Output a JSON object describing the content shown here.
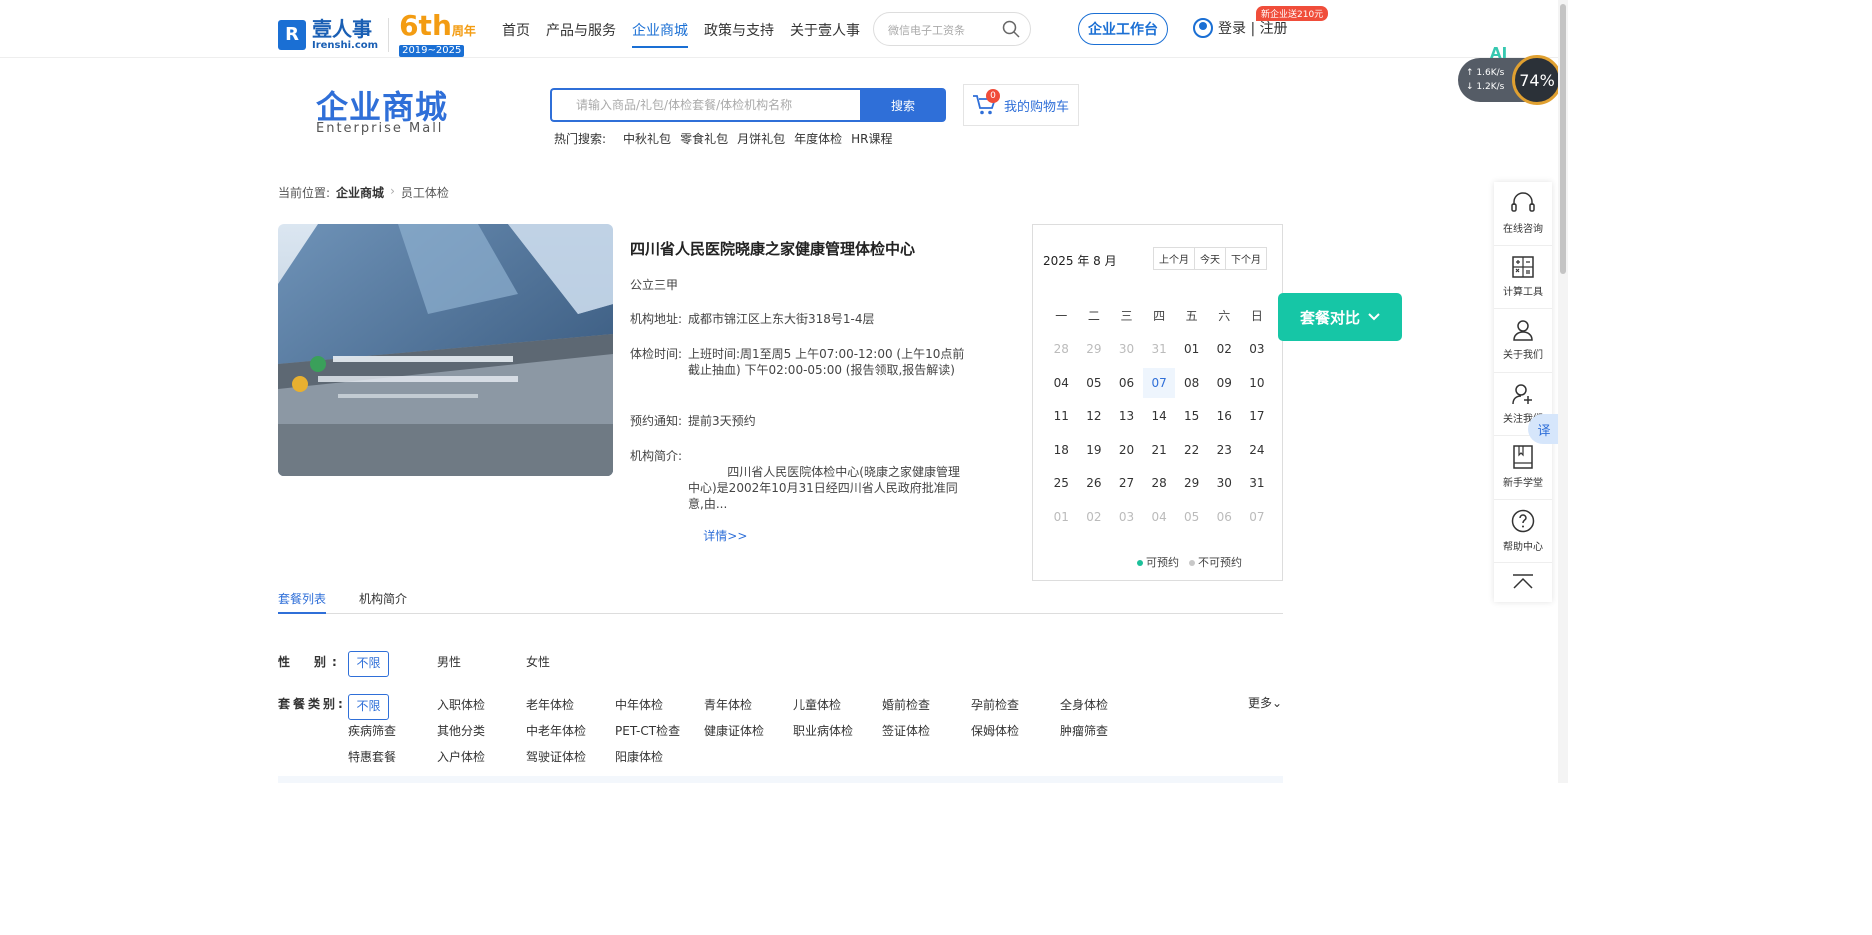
{
  "header": {
    "logo": {
      "cn": "壹人事",
      "en": "Irenshi.com",
      "mark": "R"
    },
    "anniversary": {
      "big": "6th",
      "small": "周年",
      "years": "2019~2025"
    },
    "nav": [
      "首页",
      "产品与服务",
      "企业商城",
      "政策与支持",
      "关于壹人事"
    ],
    "search_placeholder": "微信电子工资条",
    "workbench": "企业工作台",
    "login": "登录 | 注册",
    "promo": "新企业送210元"
  },
  "mall": {
    "title": "企业商城",
    "subtitle": "Enterprise  Mall",
    "search_placeholder": "请输入商品/礼包/体检套餐/体检机构名称",
    "search_button": "搜索",
    "hot_label": "热门搜索:",
    "hot": [
      "中秋礼包",
      "零食礼包",
      "月饼礼包",
      "年度体检",
      "HR课程"
    ],
    "cart_label": "我的购物车",
    "cart_count": "0"
  },
  "breadcrumb": {
    "prefix": "当前位置:",
    "items": [
      "企业商城",
      "员工体检"
    ]
  },
  "institution": {
    "name": "四川省人民医院晓康之家健康管理体检中心",
    "tag": "公立三甲",
    "address_label": "机构地址:",
    "address": "成都市锦江区上东大街318号1-4层",
    "time_label": "体检时间:",
    "time": "上班时间:周1至周5 上午07:00-12:00 (上午10点前截止抽血) 下午02:00-05:00 (报告领取,报告解读)",
    "notice_label": "预约通知:",
    "notice": "提前3天预约",
    "intro_label": "机构简介:",
    "intro": "　　四川省人民医院体检中心(晓康之家健康管理中心)是2002年10月31日经四川省人民政府批准同意,由...",
    "detail": "详情>>"
  },
  "calendar": {
    "title": "2025 年 8 月",
    "buttons": [
      "上个月",
      "今天",
      "下个月"
    ],
    "weekdays": [
      "一",
      "二",
      "三",
      "四",
      "五",
      "六",
      "日"
    ],
    "weeks": [
      [
        "28",
        "29",
        "30",
        "31",
        "01",
        "02",
        "03"
      ],
      [
        "04",
        "05",
        "06",
        "07",
        "08",
        "09",
        "10"
      ],
      [
        "11",
        "12",
        "13",
        "14",
        "15",
        "16",
        "17"
      ],
      [
        "18",
        "19",
        "20",
        "21",
        "22",
        "23",
        "24"
      ],
      [
        "25",
        "26",
        "27",
        "28",
        "29",
        "30",
        "31"
      ],
      [
        "01",
        "02",
        "03",
        "04",
        "05",
        "06",
        "07"
      ]
    ],
    "today": "07",
    "legend_available": "可预约",
    "legend_unavailable": "不可预约",
    "available_color": "#1cc09a",
    "unavailable_color": "#c8c8c8"
  },
  "compare_button": "套餐对比",
  "tabs": [
    "套餐列表",
    "机构简介"
  ],
  "filters": {
    "gender_label": "性　别:",
    "gender": [
      "不限",
      "男性",
      "女性"
    ],
    "type_label": "套餐类别:",
    "types": [
      "不限",
      "入职体检",
      "老年体检",
      "中年体检",
      "青年体检",
      "儿童体检",
      "婚前检查",
      "孕前检查",
      "全身体检",
      "疾病筛查",
      "其他分类",
      "中老年体检",
      "PET-CT检查",
      "健康证体检",
      "职业病体检",
      "签证体检",
      "保姆体检",
      "肿瘤筛查",
      "特惠套餐",
      "入户体检",
      "驾驶证体检",
      "阳康体检"
    ],
    "more": "更多"
  },
  "sidebar": [
    "在线咨询",
    "计算工具",
    "关于我们",
    "关注我们",
    "新手学堂",
    "帮助中心"
  ],
  "speed": {
    "up": "1.6K/s",
    "down": "1.2K/s",
    "percent": "74%"
  },
  "ai_label": "AI",
  "translate_label": "译",
  "accent": "#2f6fd8"
}
